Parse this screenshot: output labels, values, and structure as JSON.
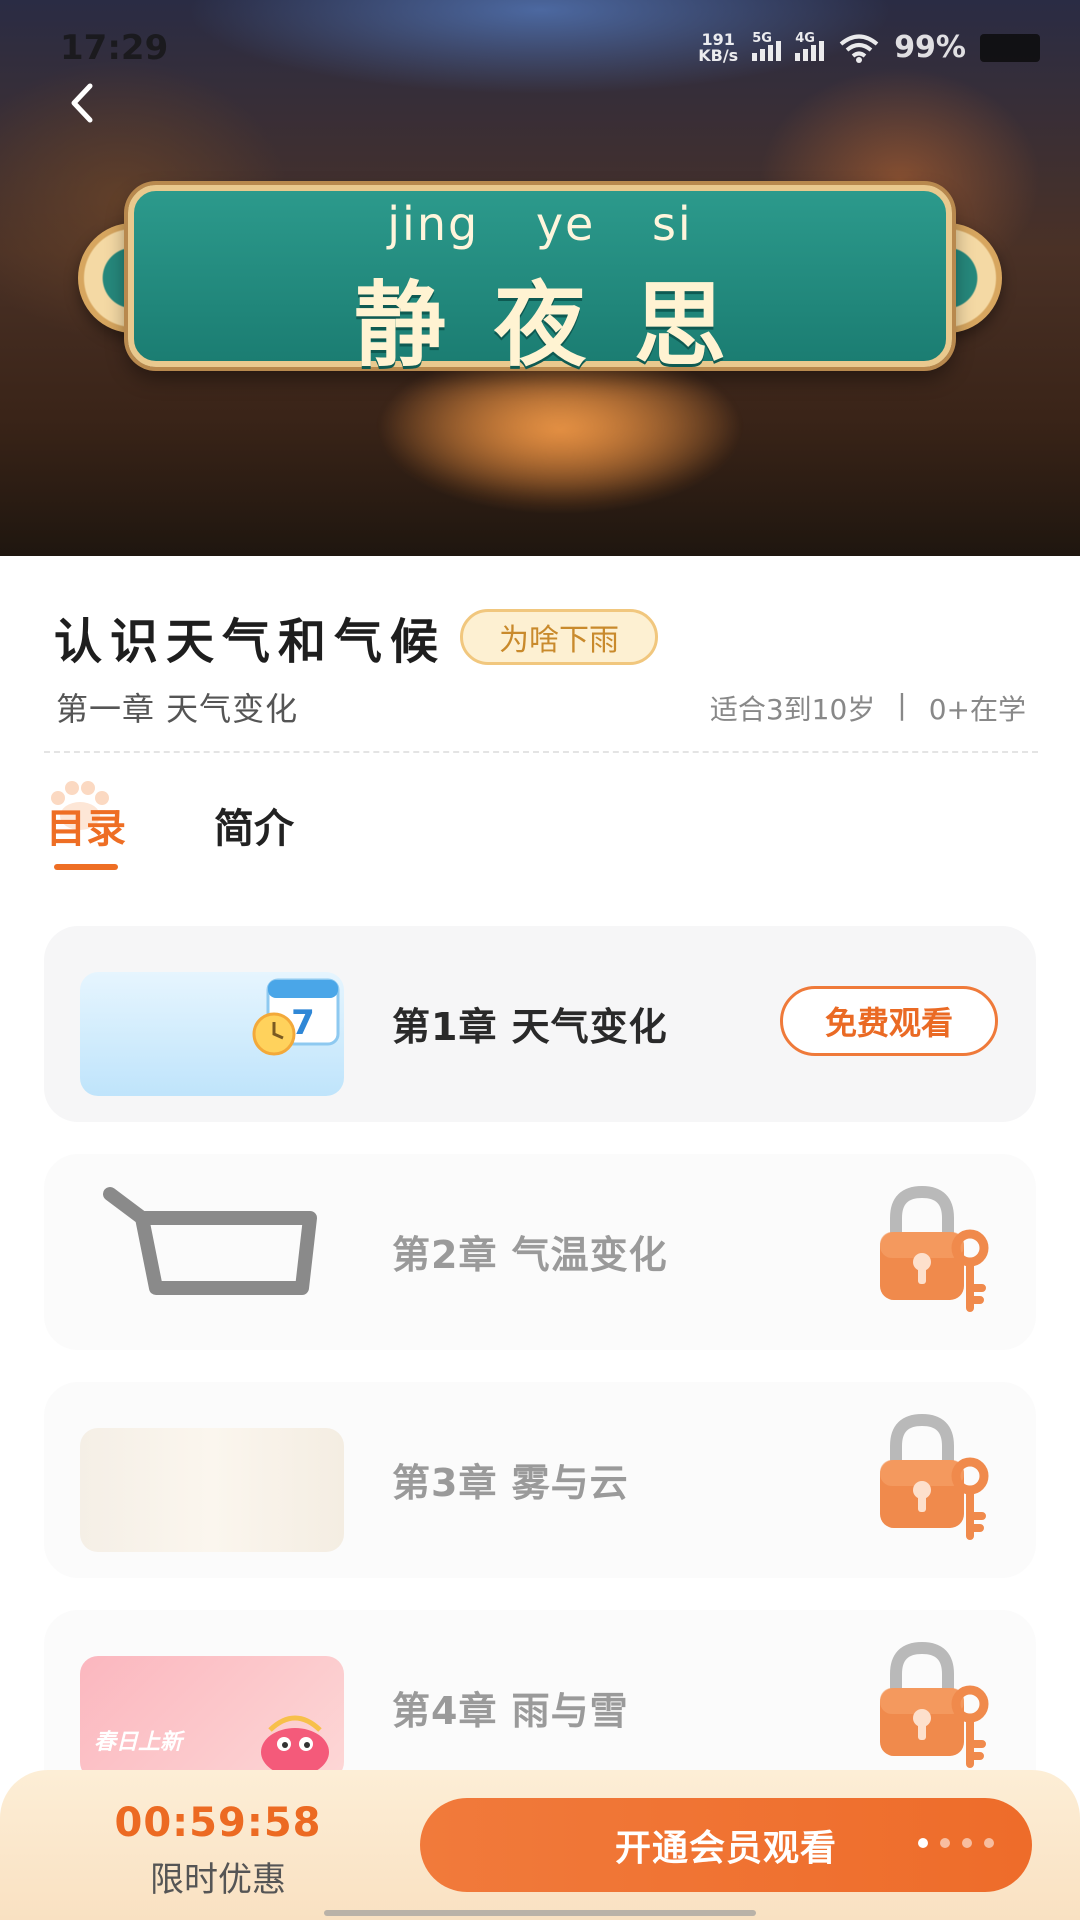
{
  "status_bar": {
    "time": "17:29",
    "net_speed_value": "191",
    "net_speed_unit": "KB/s",
    "signal_1_label": "5G",
    "signal_2_label": "4G",
    "battery": "99%"
  },
  "hero": {
    "pinyin": "jing  ye  si",
    "poem_title": "静夜思"
  },
  "course": {
    "title": "认识天气和气候",
    "tag": "为啥下雨",
    "chapter_subtitle": "第一章 天气变化",
    "age_range": "适合3到10岁",
    "separator": "|",
    "learners": "0+在学"
  },
  "tabs": [
    {
      "label": "目录",
      "active": true
    },
    {
      "label": "简介",
      "active": false
    }
  ],
  "chapters": [
    {
      "title": "第1章 天气变化",
      "locked": false,
      "action_label": "免费观看"
    },
    {
      "title": "第2章 气温变化",
      "locked": true
    },
    {
      "title": "第3章 雾与云",
      "locked": true
    },
    {
      "title": "第4章 雨与雪",
      "locked": true,
      "thumb_text": "春日上新"
    }
  ],
  "bottom_bar": {
    "countdown": "00:59:58",
    "promo_label": "限时优惠",
    "vip_button_label": "开通会员观看"
  },
  "colors": {
    "accent": "#EE6E24",
    "tag_text": "#C98A2C",
    "plaque_teal": "#1B7D72"
  }
}
